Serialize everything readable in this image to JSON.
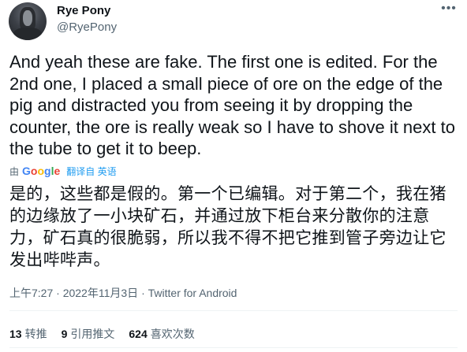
{
  "author": {
    "name": "Rye Pony",
    "handle": "@RyePony",
    "more_icon": "more-dots-icon"
  },
  "tweet": {
    "text": "And yeah these are fake. The first one is edited. For the 2nd one, I placed a small piece of ore on the edge of the pig and distracted you from seeing it by dropping the counter, the ore is really weak so I have to shove it next to the tube to get it to beep.",
    "translated_by": "由",
    "google": {
      "letters": [
        "G",
        "o",
        "o",
        "g",
        "l",
        "e"
      ],
      "colors": [
        "#4285f4",
        "#ea4335",
        "#fbbc05",
        "#4285f4",
        "#34a853",
        "#ea4335"
      ]
    },
    "translate_label": "翻译自 英语",
    "translation": "是的，这些都是假的。第一个已编辑。对于第二个，我在猪的边缘放了一小块矿石，并通过放下柜台来分散你的注意力，矿石真的很脆弱，所以我不得不把它推到管子旁边让它发出哔哔声。"
  },
  "meta": {
    "time": "上午7:27",
    "separator": "·",
    "date": "2022年11月3日",
    "app": "Twitter for Android"
  },
  "stats": [
    {
      "count": "13",
      "label": "转推"
    },
    {
      "count": "9",
      "label": "引用推文"
    },
    {
      "count": "624",
      "label": "喜欢次数"
    }
  ],
  "colors": {
    "text": "#0f1419",
    "secondary": "#536471",
    "link": "#1d9bf0",
    "divider": "#eff3f4"
  }
}
